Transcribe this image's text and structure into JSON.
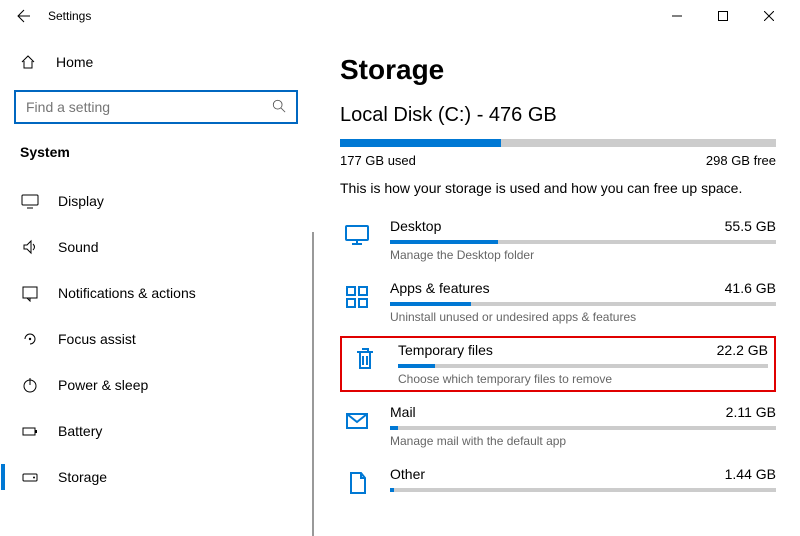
{
  "titlebar": {
    "title": "Settings"
  },
  "sidebar": {
    "home_label": "Home",
    "search_placeholder": "Find a setting",
    "category": "System",
    "items": [
      {
        "label": "Display"
      },
      {
        "label": "Sound"
      },
      {
        "label": "Notifications & actions"
      },
      {
        "label": "Focus assist"
      },
      {
        "label": "Power & sleep"
      },
      {
        "label": "Battery"
      },
      {
        "label": "Storage"
      }
    ]
  },
  "main": {
    "heading": "Storage",
    "disk_title": "Local Disk (C:) - 476 GB",
    "used_label": "177 GB used",
    "free_label": "298 GB free",
    "used_pct": 37,
    "desc": "This is how your storage is used and how you can free up space.",
    "categories": [
      {
        "name": "Desktop",
        "size": "55.5 GB",
        "pct": 28,
        "sub": "Manage the Desktop folder",
        "icon": "desktop"
      },
      {
        "name": "Apps & features",
        "size": "41.6 GB",
        "pct": 21,
        "sub": "Uninstall unused or undesired apps & features",
        "icon": "apps"
      },
      {
        "name": "Temporary files",
        "size": "22.2 GB",
        "pct": 10,
        "sub": "Choose which temporary files to remove",
        "icon": "trash",
        "highlight": true
      },
      {
        "name": "Mail",
        "size": "2.11 GB",
        "pct": 2,
        "sub": "Manage mail with the default app",
        "icon": "mail"
      },
      {
        "name": "Other",
        "size": "1.44 GB",
        "pct": 1,
        "sub": "",
        "icon": "other"
      }
    ]
  }
}
